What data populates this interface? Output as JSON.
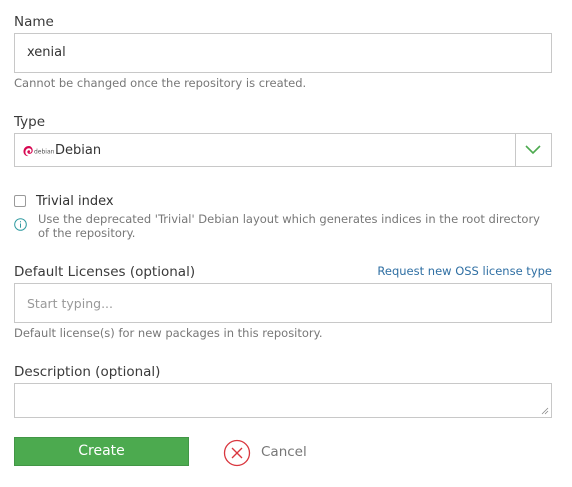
{
  "name": {
    "label": "Name",
    "value": "xenial",
    "hint": "Cannot be changed once the repository is created."
  },
  "type": {
    "label": "Type",
    "logo_text": "debian",
    "value": "Debian",
    "icon": "chevron-down-icon"
  },
  "trivial": {
    "label": "Trivial index",
    "checked": false,
    "description": "Use the deprecated 'Trivial' Debian layout which generates indices in the root directory of the repository."
  },
  "licenses": {
    "label": "Default Licenses (optional)",
    "request_link": "Request new OSS license type",
    "placeholder": "Start typing...",
    "hint": "Default license(s) for new packages in this repository."
  },
  "description": {
    "label": "Description (optional)",
    "value": ""
  },
  "actions": {
    "create_label": "Create",
    "cancel_label": "Cancel"
  },
  "colors": {
    "accent_green": "#4caa4f",
    "cancel_red": "#d9363e",
    "link_blue": "#2f6fa3",
    "debian_red": "#d70751"
  }
}
